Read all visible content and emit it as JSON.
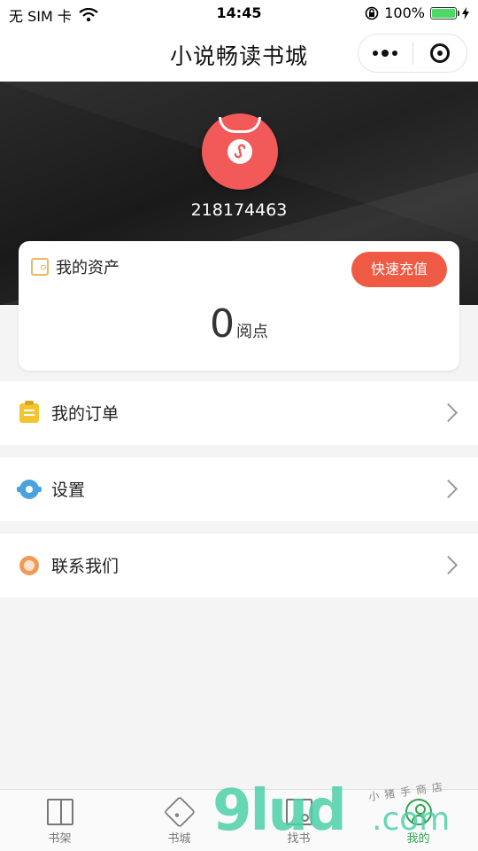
{
  "status_bar": {
    "carrier": "无 SIM 卡",
    "time": "14:45",
    "battery": "100%",
    "battery_level": 1.0
  },
  "nav": {
    "title": "小说畅读书城"
  },
  "profile": {
    "user_id": "218174463"
  },
  "assets": {
    "title": "我的资产",
    "recharge_label": "快速充值",
    "balance": "0",
    "unit": "阅点"
  },
  "menu": [
    {
      "label": "我的订单",
      "icon": "clipboard-icon"
    },
    {
      "label": "设置",
      "icon": "gear-icon"
    },
    {
      "label": "联系我们",
      "icon": "customer-service-icon"
    }
  ],
  "tabs": [
    {
      "label": "书架",
      "icon": "book-icon"
    },
    {
      "label": "书城",
      "icon": "tag-icon"
    },
    {
      "label": "找书",
      "icon": "search-book-icon"
    },
    {
      "label": "我的",
      "icon": "user-icon",
      "active": true
    }
  ],
  "watermark": {
    "big": "9lud",
    "com": ".com",
    "small": "小猪手商店"
  },
  "colors": {
    "accent": "#ef5a44",
    "avatar": "#f25a5a",
    "active_tab": "#2da44e",
    "watermark": "#4dd0a8"
  }
}
